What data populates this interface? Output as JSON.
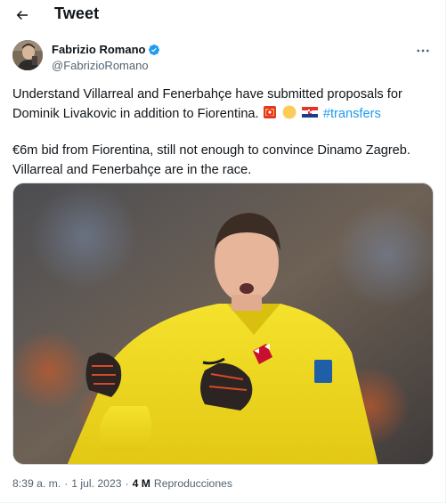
{
  "header": {
    "title": "Tweet"
  },
  "author": {
    "name": "Fabrizio Romano",
    "handle": "@FabrizioRomano",
    "verified": true
  },
  "tweet": {
    "paragraph1": "Understand Villarreal and Fenerbahçe have submitted proposals for Dominik Livakovic in addition to Fiorentina.",
    "hashtag": "#transfers",
    "paragraph2_line1": "€6m bid from Fiorentina, still not enough to convince Dinamo Zagreb.",
    "paragraph2_line2": "Villarreal and Fenerbahçe are in the race.",
    "emojis": [
      "spain-flag-icon",
      "yellow-circle-icon",
      "croatia-flag-icon"
    ]
  },
  "meta": {
    "time": "8:39 a. m.",
    "separator": "·",
    "date": "1 jul. 2023",
    "views_count": "4 M",
    "views_label": "Reproducciones"
  },
  "colors": {
    "accent": "#1d9bf0",
    "text": "#0f1419",
    "secondary": "#536471",
    "jersey": "#f2d91f"
  }
}
